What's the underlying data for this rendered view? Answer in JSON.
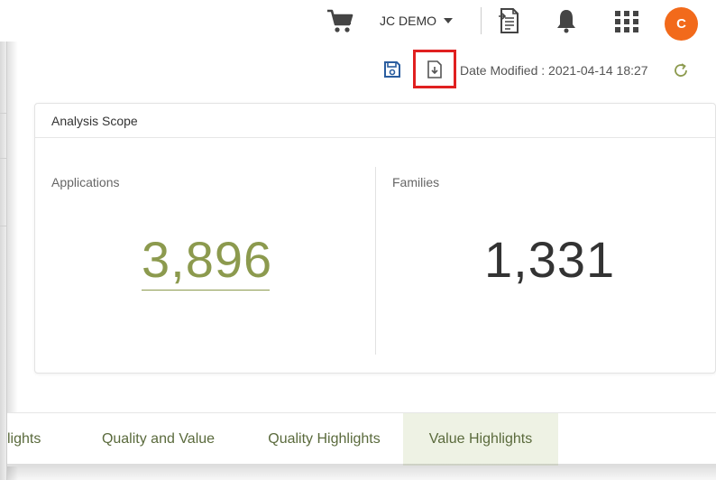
{
  "topbar": {
    "cart_icon": "cart-icon",
    "user_name": "JC DEMO",
    "export_icon": "export-doc-icon",
    "bell_icon": "bell-icon",
    "apps_icon": "apps-grid-icon",
    "avatar_initial": "C",
    "avatar_color": "#f26a1b"
  },
  "toolbar": {
    "save_icon": "save-icon",
    "download_icon": "download-report-icon",
    "highlight_color": "#e02020",
    "date_modified": "Date Modified : 2021-04-14 18:27",
    "refresh_icon": "refresh-icon"
  },
  "scope": {
    "title": "Analysis Scope",
    "applications_label": "Applications",
    "applications_value": "3,896",
    "families_label": "Families",
    "families_value": "1,331",
    "accent_color": "#8c9a4e"
  },
  "tabs": [
    {
      "label": "lights",
      "active": false
    },
    {
      "label": "Quality and Value",
      "active": false
    },
    {
      "label": "Quality Highlights",
      "active": false
    },
    {
      "label": "Value Highlights",
      "active": true
    }
  ]
}
